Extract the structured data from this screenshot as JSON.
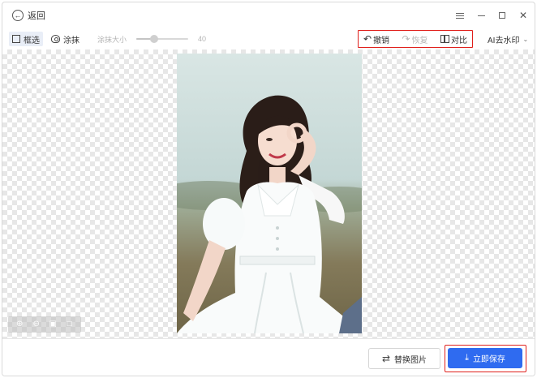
{
  "titlebar": {
    "back_label": "返回",
    "back_icon": "arrow-left-icon"
  },
  "toolbar": {
    "box_select_label": "框选",
    "brush_label": "涂抹",
    "brush_size_label": "涂抹大小",
    "brush_size_value": "40",
    "brush_size_level": 0.35,
    "undo_label": "撤销",
    "redo_label": "恢复",
    "compare_label": "对比",
    "ai_remove_label": "AI去水印"
  },
  "footer": {
    "replace_label": "替换图片",
    "save_label": "立即保存"
  },
  "colors": {
    "accent": "#2f6bf0",
    "highlight_border": "#e0201c"
  }
}
